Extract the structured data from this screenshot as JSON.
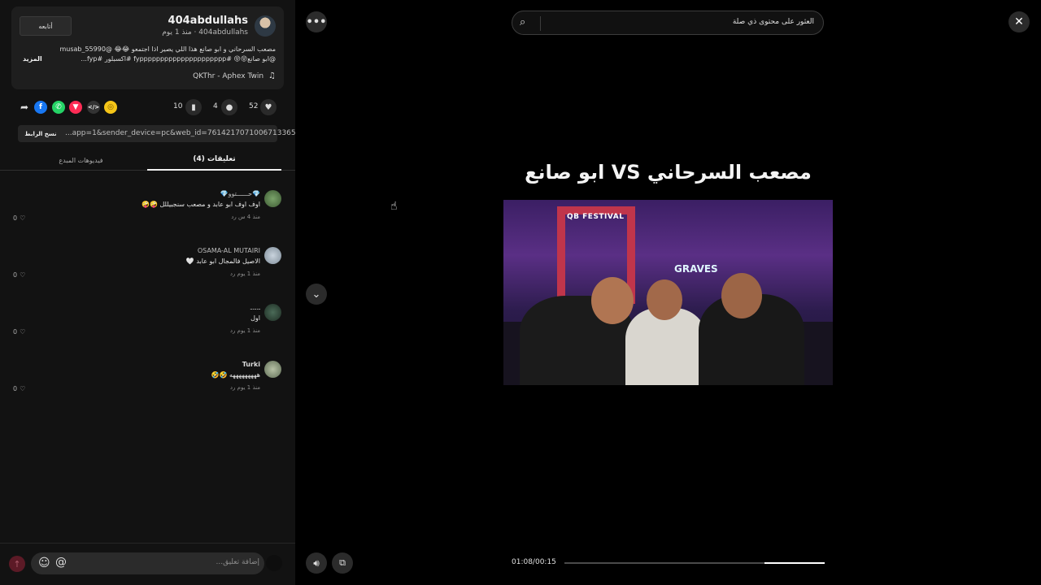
{
  "author": {
    "display_name": "404abdullahs",
    "subline": "404abdullahs · منذ 1 يوم",
    "follow_label": "أتابعه",
    "caption_line1": "مصعب السرحاني و ابو صانع هذا اللي يصير اذا اجتمعو 😂😂 @musab_55990",
    "caption_line2": "@ابو صانع😝😝 #fyppppppppppppppppppppp #اكسبلور #fyp...",
    "more_label": "المزيد",
    "music": "QKThr - Aphex Twin",
    "music_icon": "music-note-icon"
  },
  "stats": {
    "likes": "52",
    "comments": "4",
    "saves": "10"
  },
  "share_icons": [
    "share-arrow-icon",
    "facebook-icon",
    "whatsapp-icon",
    "telegram-icon",
    "embed-icon",
    "coin-icon"
  ],
  "link": {
    "copy_label": "نسخ الرابط",
    "url": "...app=1&sender_device=pc&web_id=7614217071006713365"
  },
  "tabs": {
    "comments": "تعليقات (4)",
    "creator_videos": "فيديوهات المبدع"
  },
  "comments": [
    {
      "author": "💎حــــــتوو💎",
      "text": "اوف اوف ابو عابد و مصعب سنجبيللل 🤪🤪",
      "meta": "منذ 4 س  رد",
      "likes": "0"
    },
    {
      "author": "OSAMA-AL MUTAIRI",
      "text": "الاصيل فالمجال ابو عابد 🤍",
      "meta": "منذ 1 يوم  رد",
      "likes": "0"
    },
    {
      "author": "ـ.ـ.ـ",
      "text": "اول",
      "meta": "منذ 1 يوم  رد",
      "likes": "0"
    },
    {
      "author": "Turki",
      "text": "هههههههههه 🤣🤣",
      "meta": "منذ 1 يوم  رد",
      "likes": "0"
    }
  ],
  "comment_input": {
    "placeholder": "إضافة تعليق..."
  },
  "search": {
    "text": "العثور على محتوى ذي صلة"
  },
  "video": {
    "title": "مصعب السرحاني VS ابو صانع",
    "festival_sign": "QB FESTIVAL",
    "graves_sign": "GRAVES",
    "time": "01:08/00:15",
    "progress_fraction": 0.23
  }
}
